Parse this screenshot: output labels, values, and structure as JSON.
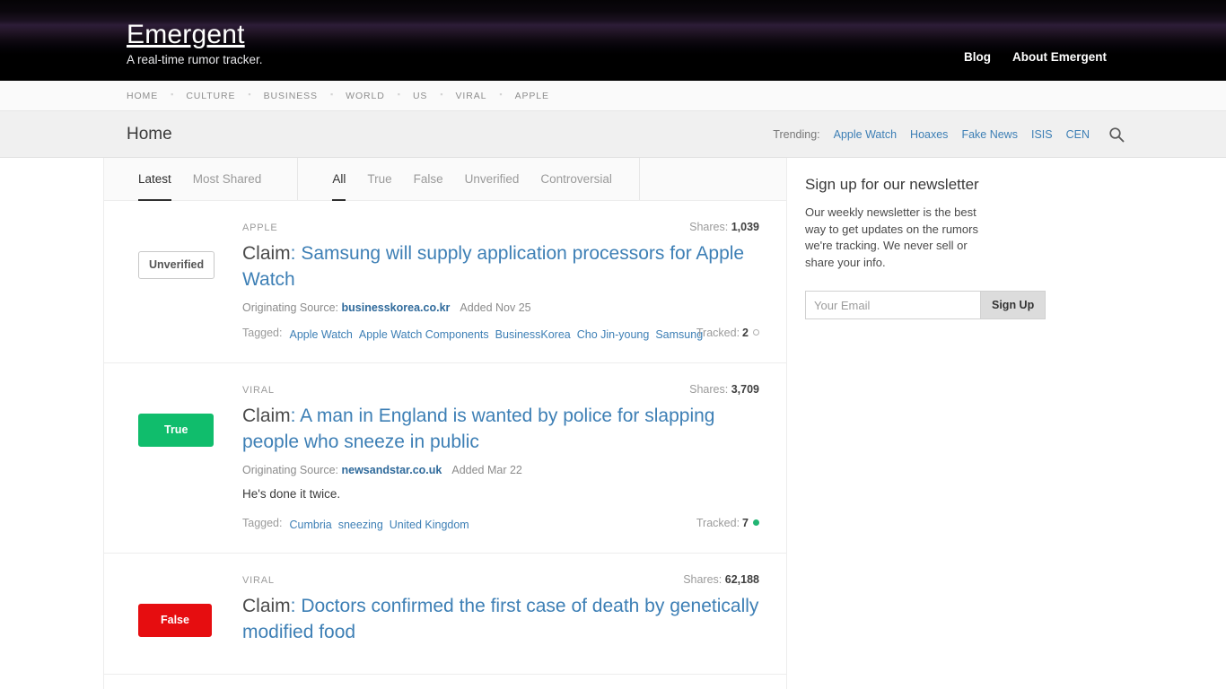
{
  "brand": {
    "title": "Emergent",
    "tagline": "A real-time rumor tracker."
  },
  "masthead_nav": [
    {
      "label": "Blog"
    },
    {
      "label": "About Emergent"
    }
  ],
  "category_nav": [
    {
      "label": "HOME"
    },
    {
      "label": "CULTURE"
    },
    {
      "label": "BUSINESS"
    },
    {
      "label": "WORLD"
    },
    {
      "label": "US"
    },
    {
      "label": "VIRAL"
    },
    {
      "label": "APPLE"
    }
  ],
  "titlebar": {
    "page_title": "Home",
    "trending_label": "Trending:",
    "trending": [
      {
        "label": "Apple Watch"
      },
      {
        "label": "Hoaxes"
      },
      {
        "label": "Fake News"
      },
      {
        "label": "ISIS"
      },
      {
        "label": "CEN"
      }
    ],
    "search_icon": "search-icon"
  },
  "sort_tabs": [
    {
      "label": "Latest",
      "active": true
    },
    {
      "label": "Most Shared",
      "active": false
    }
  ],
  "filter_tabs": [
    {
      "label": "All",
      "active": true
    },
    {
      "label": "True",
      "active": false
    },
    {
      "label": "False",
      "active": false
    },
    {
      "label": "Unverified",
      "active": false
    },
    {
      "label": "Controversial",
      "active": false
    }
  ],
  "labels": {
    "shares": "Shares:",
    "originating_source": "Originating Source:",
    "tagged": "Tagged:",
    "tracked": "Tracked:"
  },
  "claims": [
    {
      "badge": "Unverified",
      "badge_type": "unverified",
      "category": "APPLE",
      "shares": "1,039",
      "title_lead": "Claim",
      "title": ": Samsung will supply application processors for Apple Watch",
      "source": "businesskorea.co.kr",
      "added": "Added Nov 25",
      "description": "",
      "tags": [
        {
          "label": "Apple Watch"
        },
        {
          "label": "Apple Watch Components"
        },
        {
          "label": "BusinessKorea"
        },
        {
          "label": "Cho Jin-young"
        },
        {
          "label": "Samsung"
        }
      ],
      "tracked": "2",
      "tracked_dot": "hollow"
    },
    {
      "badge": "True",
      "badge_type": "true",
      "category": "VIRAL",
      "shares": "3,709",
      "title_lead": "Claim",
      "title": ": A man in England is wanted by police for slapping people who sneeze in public",
      "source": "newsandstar.co.uk",
      "added": "Added Mar 22",
      "description": "He's done it twice.",
      "tags": [
        {
          "label": "Cumbria"
        },
        {
          "label": "sneezing"
        },
        {
          "label": "United Kingdom"
        }
      ],
      "tracked": "7",
      "tracked_dot": "green"
    },
    {
      "badge": "False",
      "badge_type": "false",
      "category": "VIRAL",
      "shares": "62,188",
      "title_lead": "Claim",
      "title": ": Doctors confirmed the first case of death by genetically modified food",
      "source": "",
      "added": "",
      "description": "",
      "tags": [],
      "tracked": "",
      "tracked_dot": ""
    }
  ],
  "sidebar": {
    "title": "Sign up for our newsletter",
    "text": "Our weekly newsletter is the best way to get updates on the rumors we're tracking. We never sell or share your info.",
    "email_placeholder": "Your Email",
    "email_value": "",
    "signup_label": "Sign Up"
  },
  "colors": {
    "accent_link": "#3d7fb5",
    "true_green": "#10bd6c",
    "false_red": "#e60d10",
    "tracked_green": "#22b573"
  }
}
